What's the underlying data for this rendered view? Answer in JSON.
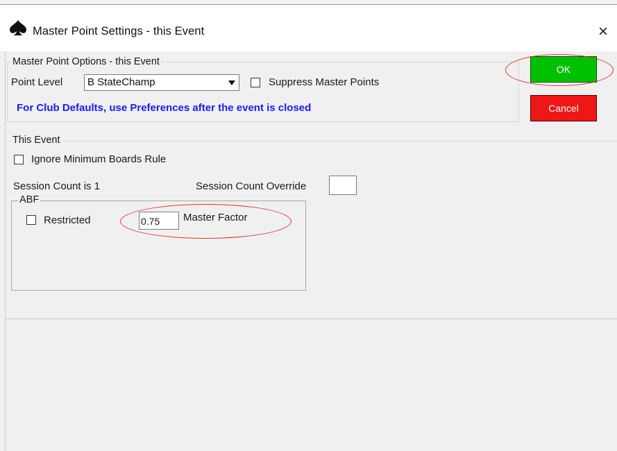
{
  "window": {
    "title": "Master Point Settings - this Event",
    "close_glyph": "×",
    "app_icon": "spade-icon"
  },
  "mp_options": {
    "legend": "Master Point Options - this Event",
    "point_level_label": "Point Level",
    "point_level_value": "B StateChamp",
    "suppress_label": "Suppress  Master Points",
    "suppress_checked": false,
    "info_text": "For Club Defaults, use Preferences after the event is closed"
  },
  "buttons": {
    "ok_label": "OK",
    "cancel_label": "Cancel",
    "ok_color": "#00c000",
    "cancel_color": "#ef1616"
  },
  "this_event": {
    "legend": "This Event",
    "ignore_min_boards_label": "Ignore Minimum Boards Rule",
    "ignore_min_boards_checked": false,
    "session_count_text": "Session Count is 1",
    "session_override_label": "Session Count Override",
    "session_override_value": ""
  },
  "abf": {
    "legend": "ABF",
    "restricted_label": "Restricted",
    "restricted_checked": false,
    "master_factor_value": "0.75",
    "master_factor_label": "Master Factor"
  },
  "highlight_color": "#e23030"
}
